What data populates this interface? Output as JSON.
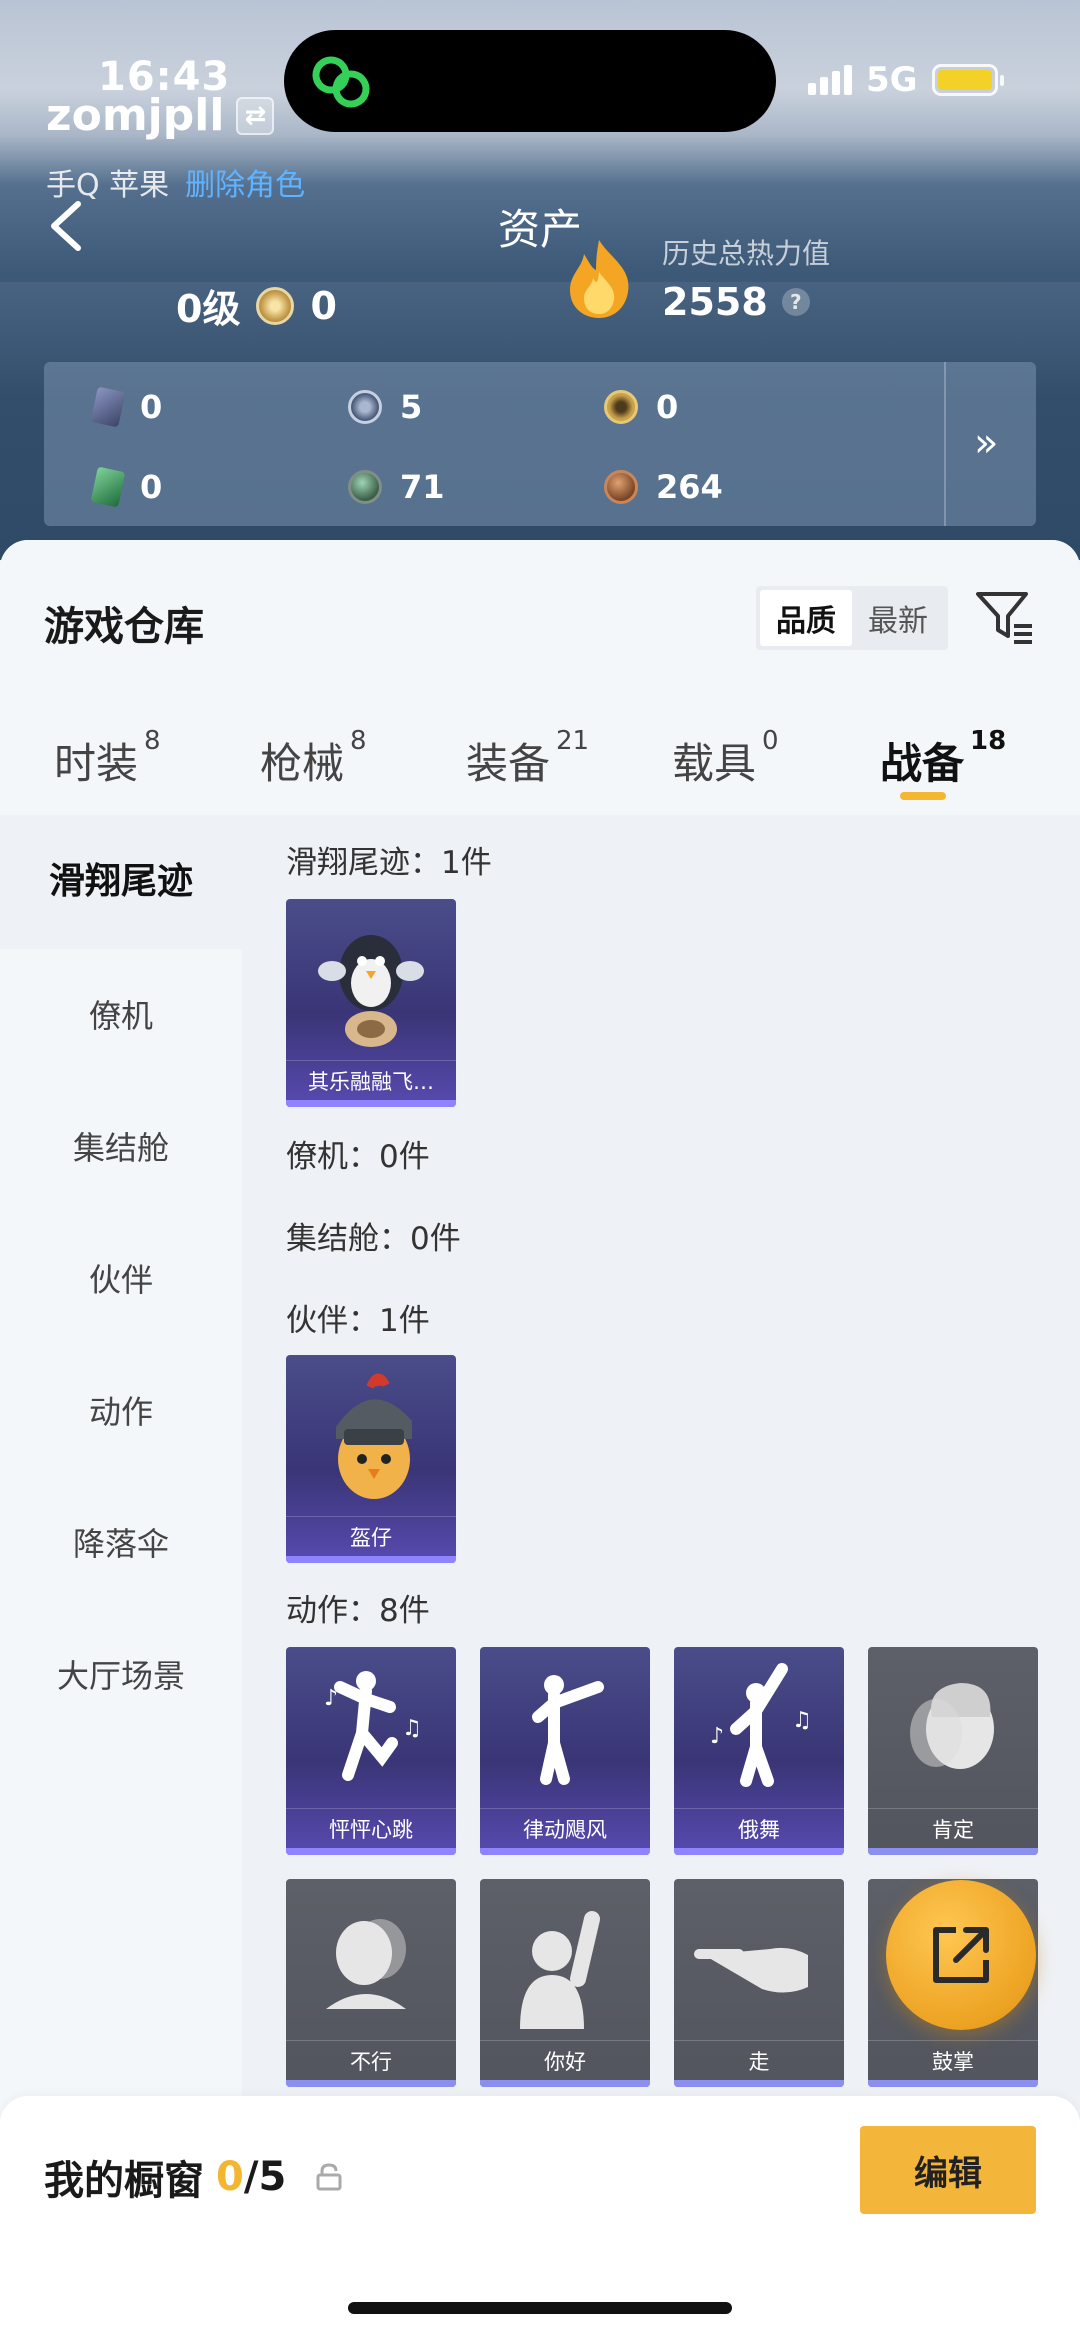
{
  "status": {
    "time": "16:43",
    "network": "5G"
  },
  "profile": {
    "username": "zomjpll",
    "platform": "手Q 苹果",
    "platform_link": "删除角色"
  },
  "header": {
    "title": "资产"
  },
  "stats": {
    "level": "0级",
    "medal_count": "0",
    "heat_label": "历史总热力值",
    "heat_value": "2558"
  },
  "currencies": [
    {
      "icon": "card-icon",
      "value": "0",
      "color": "#6f7bb0"
    },
    {
      "icon": "s-coin-icon",
      "value": "5",
      "color": "#6d7fa3"
    },
    {
      "icon": "gold-coin-icon",
      "value": "0",
      "color": "#caa24c"
    },
    {
      "icon": "green-card-icon",
      "value": "0",
      "color": "#3e9a5d"
    },
    {
      "icon": "orb-icon",
      "value": "71",
      "color": "#4d6b55"
    },
    {
      "icon": "bronze-coin-icon",
      "value": "264",
      "color": "#a8693f"
    }
  ],
  "warehouse": {
    "title": "游戏仓库",
    "sort_options": [
      "品质",
      "最新"
    ],
    "tabs": [
      {
        "label": "时装",
        "count": "8"
      },
      {
        "label": "枪械",
        "count": "8"
      },
      {
        "label": "装备",
        "count": "21"
      },
      {
        "label": "载具",
        "count": "0"
      },
      {
        "label": "战备",
        "count": "18"
      }
    ],
    "sidebar": [
      "滑翔尾迹",
      "僚机",
      "集结舱",
      "伙伴",
      "动作",
      "降落伞",
      "大厅场景"
    ],
    "sections": {
      "glide": "滑翔尾迹：1件",
      "wingman": "僚机：0件",
      "gather": "集结舱：0件",
      "partner": "伙伴：1件",
      "action": "动作：8件"
    },
    "items": {
      "glide": [
        "其乐融融飞…"
      ],
      "partner": [
        "盔仔"
      ],
      "action": [
        "怦怦心跳",
        "律动飓风",
        "俄舞",
        "肯定",
        "不行",
        "你好",
        "走",
        "鼓掌"
      ]
    }
  },
  "showcase": {
    "label": "我的橱窗",
    "count": "0",
    "total": "/5",
    "edit": "编辑"
  },
  "colors": {
    "accent": "#f4b63a",
    "tile_purple": "#3a3576",
    "tile_gray": "#55585f"
  }
}
